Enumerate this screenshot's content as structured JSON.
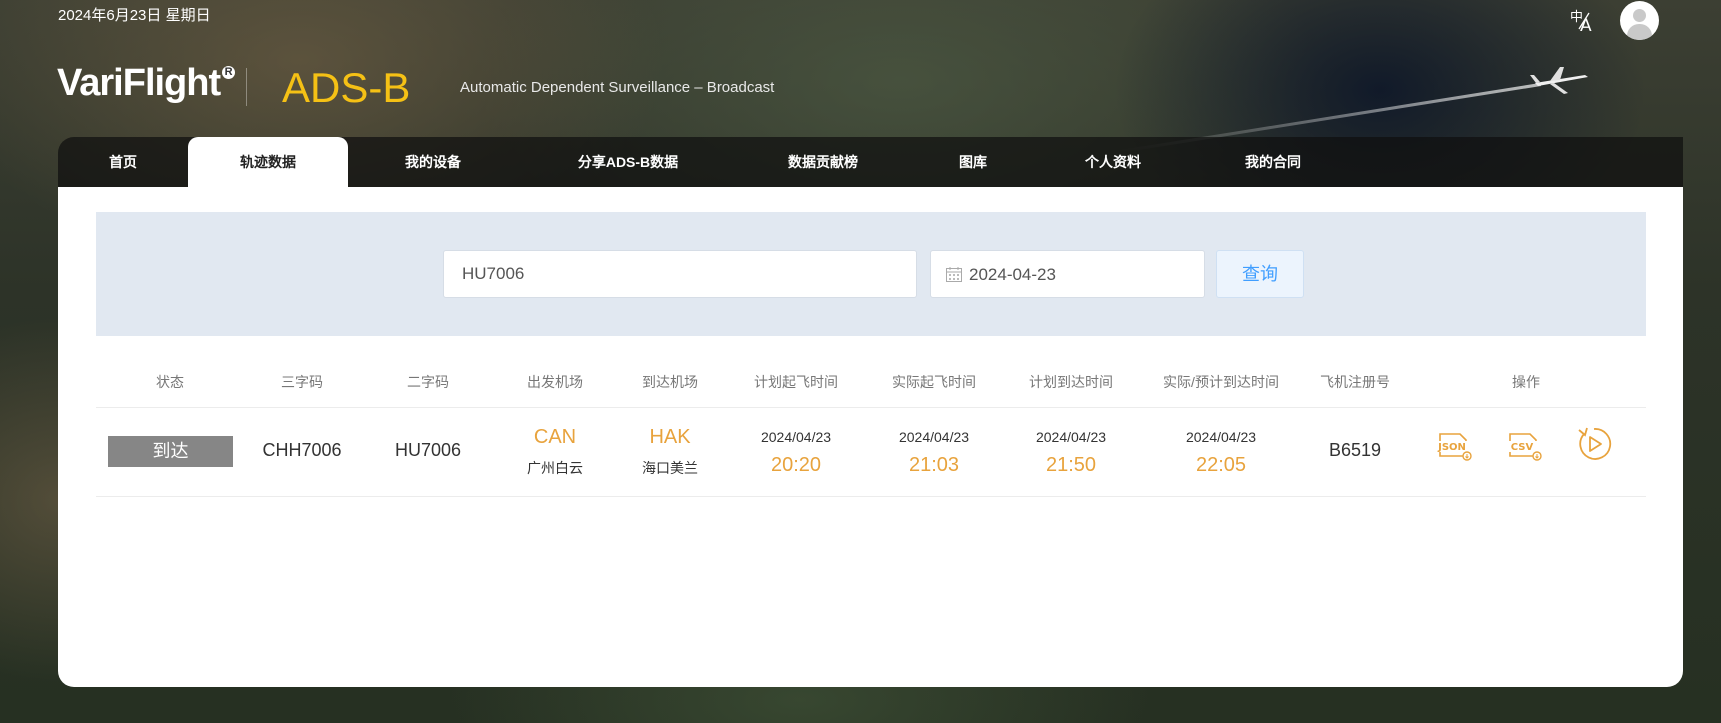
{
  "header": {
    "date": "2024年6月23日 星期日",
    "lang_icon": "translate-icon",
    "lang_glyph_zh": "中",
    "lang_glyph_a": "A",
    "avatar_icon": "user-avatar-icon",
    "logo_text": "VariFlight",
    "logo_reg": "R",
    "product": "ADS-B",
    "subtitle": "Automatic Dependent Surveillance – Broadcast"
  },
  "nav": {
    "items": [
      {
        "label": "首页"
      },
      {
        "label": "轨迹数据"
      },
      {
        "label": "我的设备"
      },
      {
        "label": "分享ADS-B数据"
      },
      {
        "label": "数据贡献榜"
      },
      {
        "label": "图库"
      },
      {
        "label": "个人资料"
      },
      {
        "label": "我的合同"
      }
    ],
    "active": "轨迹数据"
  },
  "search": {
    "flight_value": "HU7006",
    "date_value": "2024-04-23",
    "query_label": "查询",
    "calendar_icon": "calendar-icon"
  },
  "table": {
    "headers": [
      "状态",
      "三字码",
      "二字码",
      "出发机场",
      "到达机场",
      "计划起飞时间",
      "实际起飞时间",
      "计划到达时间",
      "实际/预计到达时间",
      "飞机注册号",
      "操作"
    ],
    "rows": [
      {
        "status": "到达",
        "icao_code": "CHH7006",
        "iata_code": "HU7006",
        "dep_code": "CAN",
        "dep_name": "广州白云",
        "arr_code": "HAK",
        "arr_name": "海口美兰",
        "sched_dep_date": "2024/04/23",
        "sched_dep_time": "20:20",
        "act_dep_date": "2024/04/23",
        "act_dep_time": "21:03",
        "sched_arr_date": "2024/04/23",
        "sched_arr_time": "21:50",
        "act_arr_date": "2024/04/23",
        "act_arr_time": "22:05",
        "registration": "B6519",
        "actions": [
          {
            "icon": "json-download-icon",
            "text": "JSON"
          },
          {
            "icon": "csv-download-icon",
            "text": "CSV"
          },
          {
            "icon": "playback-icon"
          }
        ]
      }
    ]
  },
  "colors": {
    "accent_orange": "#e8a33d",
    "brand_yellow": "#f5c115",
    "query_blue": "#409eff",
    "status_grey": "#868686",
    "search_bg": "#e1e8f1"
  }
}
